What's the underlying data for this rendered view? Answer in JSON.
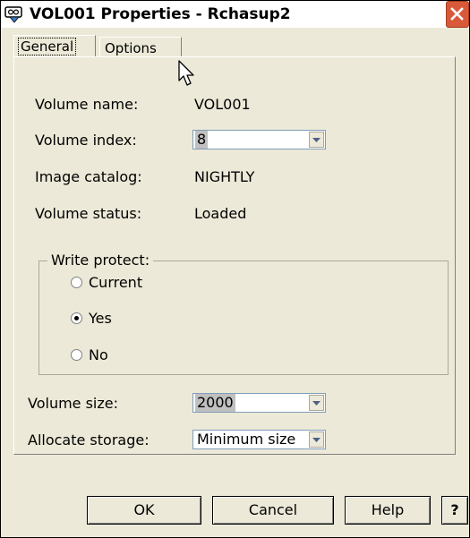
{
  "window": {
    "title": "VOL001 Properties - Rchasup2"
  },
  "tabs": [
    {
      "label": "General",
      "selected": true
    },
    {
      "label": "Options",
      "selected": false
    }
  ],
  "fields": {
    "volume_name": {
      "label": "Volume name:",
      "value": "VOL001"
    },
    "volume_index": {
      "label": "Volume index:",
      "value": "8"
    },
    "image_catalog": {
      "label": "Image catalog:",
      "value": "NIGHTLY"
    },
    "volume_status": {
      "label": "Volume status:",
      "value": "Loaded"
    },
    "volume_size": {
      "label": "Volume size:",
      "value": "2000"
    },
    "allocate_storage": {
      "label": "Allocate storage:",
      "value": "Minimum size"
    }
  },
  "write_protect": {
    "title": "Write protect:",
    "options": [
      {
        "label": "Current",
        "checked": false
      },
      {
        "label": "Yes",
        "checked": true
      },
      {
        "label": "No",
        "checked": false
      }
    ]
  },
  "buttons": {
    "ok": "OK",
    "cancel": "Cancel",
    "help": "Help",
    "whats_this": "?"
  },
  "icons": {
    "title": "window-app-icon",
    "close": "close-icon",
    "dropdown": "chevron-down-icon",
    "cursor": "mouse-pointer-icon"
  },
  "colors": {
    "close_button": "#d85a3a",
    "dialog_bg": "#ece9d8",
    "field_border": "#7f9db9"
  }
}
